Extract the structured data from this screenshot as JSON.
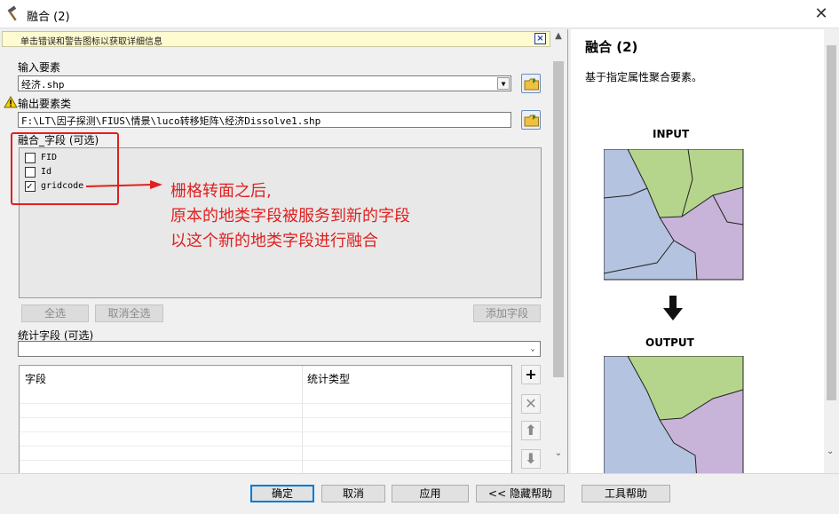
{
  "window": {
    "title": "融合 (2)",
    "app_icon": "hammer-icon",
    "close_glyph": "✕"
  },
  "message_bar": {
    "text": "单击错误和警告图标以获取详细信息",
    "close_glyph": "×"
  },
  "input_features": {
    "label": "输入要素",
    "value": "经济.shp"
  },
  "output_feature_class": {
    "label": "输出要素类",
    "value": "F:\\LT\\因子探测\\FIUS\\情景\\luco转移矩阵\\经济Dissolve1.shp",
    "warning_icon": "warning-icon"
  },
  "dissolve_fields": {
    "label": "融合_字段 (可选)",
    "items": [
      {
        "name": "FID",
        "checked": false
      },
      {
        "name": "Id",
        "checked": false
      },
      {
        "name": "gridcode",
        "checked": true
      }
    ],
    "select_all": "全选",
    "unselect_all": "取消全选",
    "add_field": "添加字段"
  },
  "annotation": {
    "color": "#e02020",
    "lines": [
      "栅格转面之后,",
      "原本的地类字段被服务到新的字段",
      "以这个新的地类字段进行融合"
    ]
  },
  "statistics_fields": {
    "label": "统计字段 (可选)",
    "col_field": "字段",
    "col_type": "统计类型"
  },
  "side_buttons": [
    "plus-icon",
    "close-icon",
    "arrow-up-icon",
    "arrow-down-icon"
  ],
  "help": {
    "title": "融合 (2)",
    "description": "基于指定属性聚合要素。",
    "input_label": "INPUT",
    "output_label": "OUTPUT"
  },
  "footer": {
    "ok": "确定",
    "cancel": "取消",
    "apply": "应用",
    "hide_help": "<< 隐藏帮助",
    "tool_help": "工具帮助"
  },
  "colors": {
    "accent": "#0078d7",
    "map_blue": "#b4c3df",
    "map_green": "#b5d58c",
    "map_purple": "#c8b4d8"
  }
}
